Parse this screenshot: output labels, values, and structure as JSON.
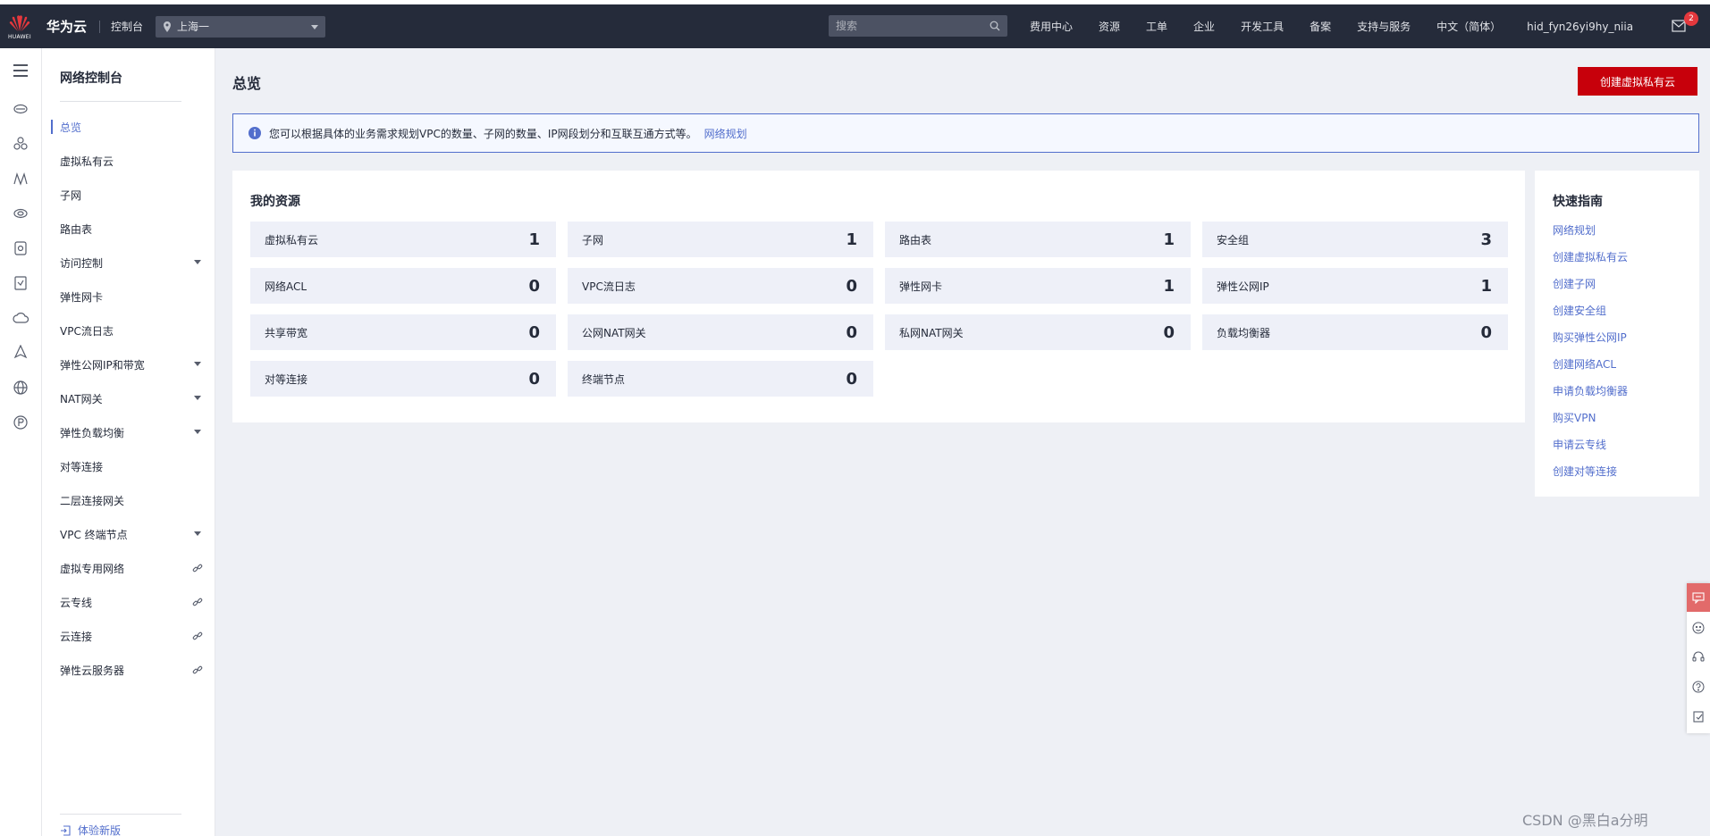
{
  "topbar": {
    "brand": "华为云",
    "logo_text": "HUAWEI",
    "console_label": "控制台",
    "region": "上海一",
    "search_placeholder": "搜索",
    "nav": [
      "费用中心",
      "资源",
      "工单",
      "企业",
      "开发工具",
      "备案",
      "支持与服务",
      "中文（简体）",
      "hid_fyn26yi9hy_niia"
    ],
    "mail_badge": "2"
  },
  "sidebar": {
    "title": "网络控制台",
    "items": [
      {
        "label": "总览"
      },
      {
        "label": "虚拟私有云"
      },
      {
        "label": "子网"
      },
      {
        "label": "路由表"
      },
      {
        "label": "访问控制"
      },
      {
        "label": "弹性网卡"
      },
      {
        "label": "VPC流日志"
      },
      {
        "label": "弹性公网IP和带宽"
      },
      {
        "label": "NAT网关"
      },
      {
        "label": "弹性负载均衡"
      },
      {
        "label": "对等连接"
      },
      {
        "label": "二层连接网关"
      },
      {
        "label": "VPC 终端节点"
      },
      {
        "label": "虚拟专用网络"
      },
      {
        "label": "云专线"
      },
      {
        "label": "云连接"
      },
      {
        "label": "弹性云服务器"
      }
    ],
    "bottom": "体验新版"
  },
  "main": {
    "title": "总览",
    "create_button": "创建虚拟私有云",
    "info_text": "您可以根据具体的业务需求规划VPC的数量、子网的数量、IP网段划分和互联互通方式等。",
    "info_link": "网络规划",
    "resources_title": "我的资源",
    "resources": [
      {
        "label": "虚拟私有云",
        "value": "1"
      },
      {
        "label": "子网",
        "value": "1"
      },
      {
        "label": "路由表",
        "value": "1"
      },
      {
        "label": "安全组",
        "value": "3"
      },
      {
        "label": "网络ACL",
        "value": "0"
      },
      {
        "label": "VPC流日志",
        "value": "0"
      },
      {
        "label": "弹性网卡",
        "value": "1"
      },
      {
        "label": "弹性公网IP",
        "value": "1"
      },
      {
        "label": "共享带宽",
        "value": "0"
      },
      {
        "label": "公网NAT网关",
        "value": "0"
      },
      {
        "label": "私网NAT网关",
        "value": "0"
      },
      {
        "label": "负载均衡器",
        "value": "0"
      },
      {
        "label": "对等连接",
        "value": "0"
      },
      {
        "label": "终端节点",
        "value": "0"
      }
    ],
    "guide_title": "快速指南",
    "guide_links": [
      "网络规划",
      "创建虚拟私有云",
      "创建子网",
      "创建安全组",
      "购买弹性公网IP",
      "创建网络ACL",
      "申请负载均衡器",
      "购买VPN",
      "申请云专线",
      "创建对等连接"
    ]
  },
  "watermark": "CSDN @黑白a分明",
  "colors": {
    "accent": "#526ecc",
    "brand_red": "#c7000b",
    "topbar": "#252b3a"
  }
}
